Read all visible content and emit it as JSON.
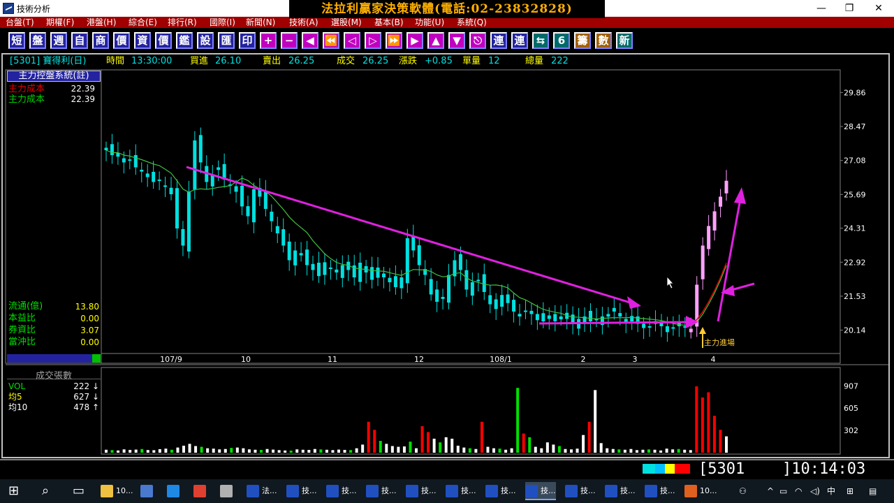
{
  "window": {
    "title": "技術分析",
    "banner": "法拉利贏家決策軟體(電話:02-23832828)",
    "min_symbol": "—",
    "max_symbol": "❐",
    "close_symbol": "✕"
  },
  "menu": [
    "台盤(T)",
    "期權(F)",
    "港盤(H)",
    "綜合(E)",
    "排行(R)",
    "國際(I)",
    "新聞(N)",
    "技術(A)",
    "選股(M)",
    "基本(B)",
    "功能(U)",
    "系統(Q)"
  ],
  "toolbar": [
    {
      "label": "短",
      "icon": "short-icon"
    },
    {
      "label": "盤",
      "icon": "board-icon"
    },
    {
      "label": "週",
      "icon": "week-icon"
    },
    {
      "label": "自",
      "icon": "self-icon"
    },
    {
      "label": "商",
      "icon": "commodity-icon"
    },
    {
      "label": "價",
      "icon": "price-icon"
    },
    {
      "label": "資",
      "icon": "capital-icon"
    },
    {
      "label": "價",
      "icon": "price2-icon"
    },
    {
      "label": "鑑",
      "icon": "review-icon"
    },
    {
      "label": "設",
      "icon": "settings-icon"
    },
    {
      "label": "匯",
      "icon": "export-icon"
    },
    {
      "label": "印",
      "icon": "print-icon"
    },
    {
      "label": "+",
      "icon": "zoom-in-icon"
    },
    {
      "label": "−",
      "icon": "zoom-out-icon"
    },
    {
      "label": "◀",
      "icon": "left-icon"
    },
    {
      "label": "⏪",
      "icon": "rewind-icon"
    },
    {
      "label": "◁",
      "icon": "step-left-icon"
    },
    {
      "label": "▷",
      "icon": "step-right-icon"
    },
    {
      "label": "⏩",
      "icon": "forward-icon"
    },
    {
      "label": "▶",
      "icon": "right-icon"
    },
    {
      "label": "▲",
      "icon": "up-icon"
    },
    {
      "label": "▼",
      "icon": "down-icon"
    },
    {
      "label": "⎋",
      "icon": "esc-icon"
    },
    {
      "label": "連",
      "icon": "link-icon"
    },
    {
      "label": "連",
      "icon": "link2-icon"
    },
    {
      "label": "⇆",
      "icon": "swap-icon"
    },
    {
      "label": "6",
      "icon": "six-icon"
    },
    {
      "label": "籌",
      "icon": "chips-icon"
    },
    {
      "label": "數",
      "icon": "stats-icon"
    },
    {
      "label": "新",
      "icon": "new-icon"
    }
  ],
  "quote": {
    "code_name": "[5301] 寶得利(日)",
    "time_label": "時間",
    "time": "13:30:00",
    "bid_label": "買進",
    "bid": "26.10",
    "ask_label": "賣出",
    "ask": "26.25",
    "deal_label": "成交",
    "deal": "26.25",
    "change_label": "漲跌",
    "change": "+0.85",
    "vol_label": "單量",
    "vol": "12",
    "total_label": "總量",
    "total": "222"
  },
  "indicator": {
    "title": "主力控盤系統(註)",
    "rows": [
      {
        "label": "主力成本",
        "value": "22.39",
        "color": "#e00000"
      },
      {
        "label": "主力成本",
        "value": "22.39",
        "color": "#00d000"
      }
    ]
  },
  "stats": [
    {
      "label": "流通(億)",
      "value": "13.80"
    },
    {
      "label": "本益比",
      "value": "0.00"
    },
    {
      "label": "券資比",
      "value": "3.07"
    },
    {
      "label": "當沖比",
      "value": "0.00"
    }
  ],
  "annotation": "主力進場",
  "volume_panel": {
    "title": "成交張數",
    "rows": [
      {
        "label": "VOL",
        "value": "222",
        "arrow": "↓"
      },
      {
        "label": "均5",
        "value": "627",
        "arrow": "↓"
      },
      {
        "label": "均10",
        "value": "478",
        "arrow": "↑"
      }
    ]
  },
  "chart_data": {
    "type": "line",
    "description_type": "candlestick",
    "price_axis": [
      "29.86",
      "28.47",
      "27.08",
      "25.69",
      "24.31",
      "22.92",
      "21.53",
      "20.14"
    ],
    "price_ylim": [
      19.5,
      30.5
    ],
    "time_axis": [
      "107/9",
      "10",
      "11",
      "12",
      "108/1",
      "2",
      "3",
      "4"
    ],
    "volume_axis": [
      "907",
      "605",
      "302"
    ],
    "close_series": [
      27.5,
      27.3,
      27.4,
      27.0,
      27.1,
      26.8,
      26.7,
      26.4,
      26.2,
      26.3,
      26.0,
      25.7,
      24.3,
      23.6,
      25.8,
      27.9,
      27.0,
      26.2,
      26.5,
      26.8,
      26.3,
      26.1,
      25.8,
      25.2,
      24.8,
      25.9,
      25.6,
      25.1,
      24.6,
      24.1,
      23.6,
      23.0,
      23.4,
      23.2,
      22.8,
      22.6,
      22.9,
      22.4,
      22.7,
      22.5,
      22.8,
      22.6,
      22.3,
      22.9,
      22.5,
      22.2,
      22.7,
      22.3,
      22.1,
      21.9,
      22.3,
      23.9,
      23.4,
      22.8,
      22.4,
      21.6,
      21.3,
      21.5,
      22.4,
      23.0,
      22.6,
      21.8,
      22.1,
      22.2,
      21.7,
      21.2,
      21.4,
      21.1,
      21.6,
      20.9,
      20.7,
      20.9,
      20.8,
      20.8,
      20.5,
      20.6,
      20.8,
      20.7,
      20.6,
      20.4,
      20.6,
      20.7,
      20.5,
      20.6,
      20.7,
      20.8,
      20.9,
      20.7,
      20.6,
      20.5,
      20.4,
      20.4,
      20.3,
      20.4,
      20.3,
      20.3,
      20.2,
      20.3,
      20.3,
      20.2,
      22.0,
      23.6,
      24.4,
      25.0,
      25.6,
      26.25
    ],
    "volume_series": [
      40,
      35,
      30,
      45,
      38,
      42,
      50,
      36,
      34,
      48,
      55,
      40,
      70,
      95,
      120,
      90,
      80,
      60,
      55,
      45,
      50,
      65,
      70,
      60,
      45,
      40,
      38,
      50,
      42,
      35,
      30,
      28,
      45,
      40,
      38,
      50,
      45,
      40,
      35,
      42,
      38,
      36,
      60,
      110,
      420,
      310,
      160,
      120,
      90,
      80,
      85,
      150,
      60,
      360,
      280,
      190,
      140,
      210,
      190,
      95,
      70,
      60,
      50,
      420,
      80,
      60,
      55,
      40,
      60,
      880,
      260,
      210,
      80,
      60,
      140,
      110,
      90,
      50,
      45,
      55,
      240,
      420,
      850,
      130,
      60,
      50,
      45,
      40,
      50,
      35,
      40,
      45,
      40,
      30,
      55,
      45,
      50,
      40,
      35,
      900,
      750,
      820,
      500,
      310,
      222
    ],
    "ma_series_note": "green moving average, red cost line"
  }
}
